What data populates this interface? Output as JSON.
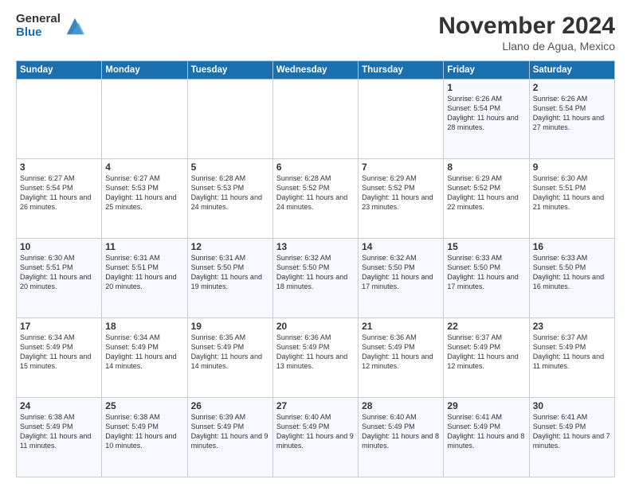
{
  "logo": {
    "general": "General",
    "blue": "Blue"
  },
  "header": {
    "month": "November 2024",
    "location": "Llano de Agua, Mexico"
  },
  "weekdays": [
    "Sunday",
    "Monday",
    "Tuesday",
    "Wednesday",
    "Thursday",
    "Friday",
    "Saturday"
  ],
  "rows": [
    [
      {
        "day": "",
        "text": ""
      },
      {
        "day": "",
        "text": ""
      },
      {
        "day": "",
        "text": ""
      },
      {
        "day": "",
        "text": ""
      },
      {
        "day": "",
        "text": ""
      },
      {
        "day": "1",
        "text": "Sunrise: 6:26 AM\nSunset: 5:54 PM\nDaylight: 11 hours and 28 minutes."
      },
      {
        "day": "2",
        "text": "Sunrise: 6:26 AM\nSunset: 5:54 PM\nDaylight: 11 hours and 27 minutes."
      }
    ],
    [
      {
        "day": "3",
        "text": "Sunrise: 6:27 AM\nSunset: 5:54 PM\nDaylight: 11 hours and 26 minutes."
      },
      {
        "day": "4",
        "text": "Sunrise: 6:27 AM\nSunset: 5:53 PM\nDaylight: 11 hours and 25 minutes."
      },
      {
        "day": "5",
        "text": "Sunrise: 6:28 AM\nSunset: 5:53 PM\nDaylight: 11 hours and 24 minutes."
      },
      {
        "day": "6",
        "text": "Sunrise: 6:28 AM\nSunset: 5:52 PM\nDaylight: 11 hours and 24 minutes."
      },
      {
        "day": "7",
        "text": "Sunrise: 6:29 AM\nSunset: 5:52 PM\nDaylight: 11 hours and 23 minutes."
      },
      {
        "day": "8",
        "text": "Sunrise: 6:29 AM\nSunset: 5:52 PM\nDaylight: 11 hours and 22 minutes."
      },
      {
        "day": "9",
        "text": "Sunrise: 6:30 AM\nSunset: 5:51 PM\nDaylight: 11 hours and 21 minutes."
      }
    ],
    [
      {
        "day": "10",
        "text": "Sunrise: 6:30 AM\nSunset: 5:51 PM\nDaylight: 11 hours and 20 minutes."
      },
      {
        "day": "11",
        "text": "Sunrise: 6:31 AM\nSunset: 5:51 PM\nDaylight: 11 hours and 20 minutes."
      },
      {
        "day": "12",
        "text": "Sunrise: 6:31 AM\nSunset: 5:50 PM\nDaylight: 11 hours and 19 minutes."
      },
      {
        "day": "13",
        "text": "Sunrise: 6:32 AM\nSunset: 5:50 PM\nDaylight: 11 hours and 18 minutes."
      },
      {
        "day": "14",
        "text": "Sunrise: 6:32 AM\nSunset: 5:50 PM\nDaylight: 11 hours and 17 minutes."
      },
      {
        "day": "15",
        "text": "Sunrise: 6:33 AM\nSunset: 5:50 PM\nDaylight: 11 hours and 17 minutes."
      },
      {
        "day": "16",
        "text": "Sunrise: 6:33 AM\nSunset: 5:50 PM\nDaylight: 11 hours and 16 minutes."
      }
    ],
    [
      {
        "day": "17",
        "text": "Sunrise: 6:34 AM\nSunset: 5:49 PM\nDaylight: 11 hours and 15 minutes."
      },
      {
        "day": "18",
        "text": "Sunrise: 6:34 AM\nSunset: 5:49 PM\nDaylight: 11 hours and 14 minutes."
      },
      {
        "day": "19",
        "text": "Sunrise: 6:35 AM\nSunset: 5:49 PM\nDaylight: 11 hours and 14 minutes."
      },
      {
        "day": "20",
        "text": "Sunrise: 6:36 AM\nSunset: 5:49 PM\nDaylight: 11 hours and 13 minutes."
      },
      {
        "day": "21",
        "text": "Sunrise: 6:36 AM\nSunset: 5:49 PM\nDaylight: 11 hours and 12 minutes."
      },
      {
        "day": "22",
        "text": "Sunrise: 6:37 AM\nSunset: 5:49 PM\nDaylight: 11 hours and 12 minutes."
      },
      {
        "day": "23",
        "text": "Sunrise: 6:37 AM\nSunset: 5:49 PM\nDaylight: 11 hours and 11 minutes."
      }
    ],
    [
      {
        "day": "24",
        "text": "Sunrise: 6:38 AM\nSunset: 5:49 PM\nDaylight: 11 hours and 11 minutes."
      },
      {
        "day": "25",
        "text": "Sunrise: 6:38 AM\nSunset: 5:49 PM\nDaylight: 11 hours and 10 minutes."
      },
      {
        "day": "26",
        "text": "Sunrise: 6:39 AM\nSunset: 5:49 PM\nDaylight: 11 hours and 9 minutes."
      },
      {
        "day": "27",
        "text": "Sunrise: 6:40 AM\nSunset: 5:49 PM\nDaylight: 11 hours and 9 minutes."
      },
      {
        "day": "28",
        "text": "Sunrise: 6:40 AM\nSunset: 5:49 PM\nDaylight: 11 hours and 8 minutes."
      },
      {
        "day": "29",
        "text": "Sunrise: 6:41 AM\nSunset: 5:49 PM\nDaylight: 11 hours and 8 minutes."
      },
      {
        "day": "30",
        "text": "Sunrise: 6:41 AM\nSunset: 5:49 PM\nDaylight: 11 hours and 7 minutes."
      }
    ]
  ]
}
